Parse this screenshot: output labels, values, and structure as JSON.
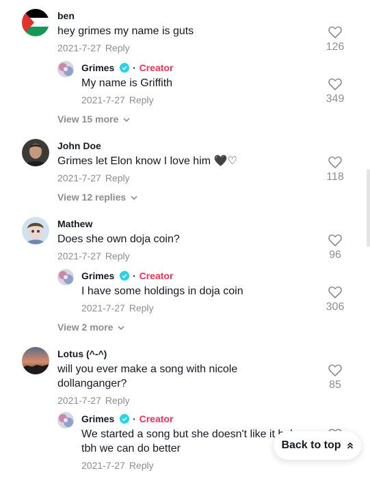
{
  "colors": {
    "creator": "#fe2c55",
    "verified": "#20d5ec",
    "muted": "#8a8b91"
  },
  "comments": [
    {
      "author": "ben",
      "text": "hey grimes my name is guts",
      "date": "2021-7-27",
      "reply_label": "Reply",
      "likes": "126",
      "avatar": "palestine-flag-avatar",
      "replies": [
        {
          "author": "Grimes",
          "creator_label": "Creator",
          "text": "My name is Griffith",
          "date": "2021-7-27",
          "reply_label": "Reply",
          "likes": "349"
        }
      ],
      "view_more": "View 15 more"
    },
    {
      "author": "John Doe",
      "text": "Grimes let Elon know I love him 🖤♡",
      "date": "2021-7-27",
      "reply_label": "Reply",
      "likes": "118",
      "avatar": "man-photo-avatar",
      "view_more": "View 12 replies"
    },
    {
      "author": "Mathew",
      "text": "Does she own doja coin?",
      "date": "2021-7-27",
      "reply_label": "Reply",
      "likes": "96",
      "avatar": "cartoon-avatar",
      "replies": [
        {
          "author": "Grimes",
          "creator_label": "Creator",
          "text": "I have some holdings in doja coin",
          "date": "2021-7-27",
          "reply_label": "Reply",
          "likes": "306"
        }
      ],
      "view_more": "View 2 more"
    },
    {
      "author": "Lotus (^-^)",
      "text": "will you ever make a song with nicole dollanganger?",
      "date": "2021-7-27",
      "reply_label": "Reply",
      "likes": "85",
      "avatar": "sunset-avatar",
      "replies": [
        {
          "author": "Grimes",
          "creator_label": "Creator",
          "text": "We started a song but she doesn't like it haha tbh we can do better",
          "date": "2021-7-27",
          "reply_label": "Reply"
        }
      ]
    }
  ],
  "back_to_top": "Back to top"
}
